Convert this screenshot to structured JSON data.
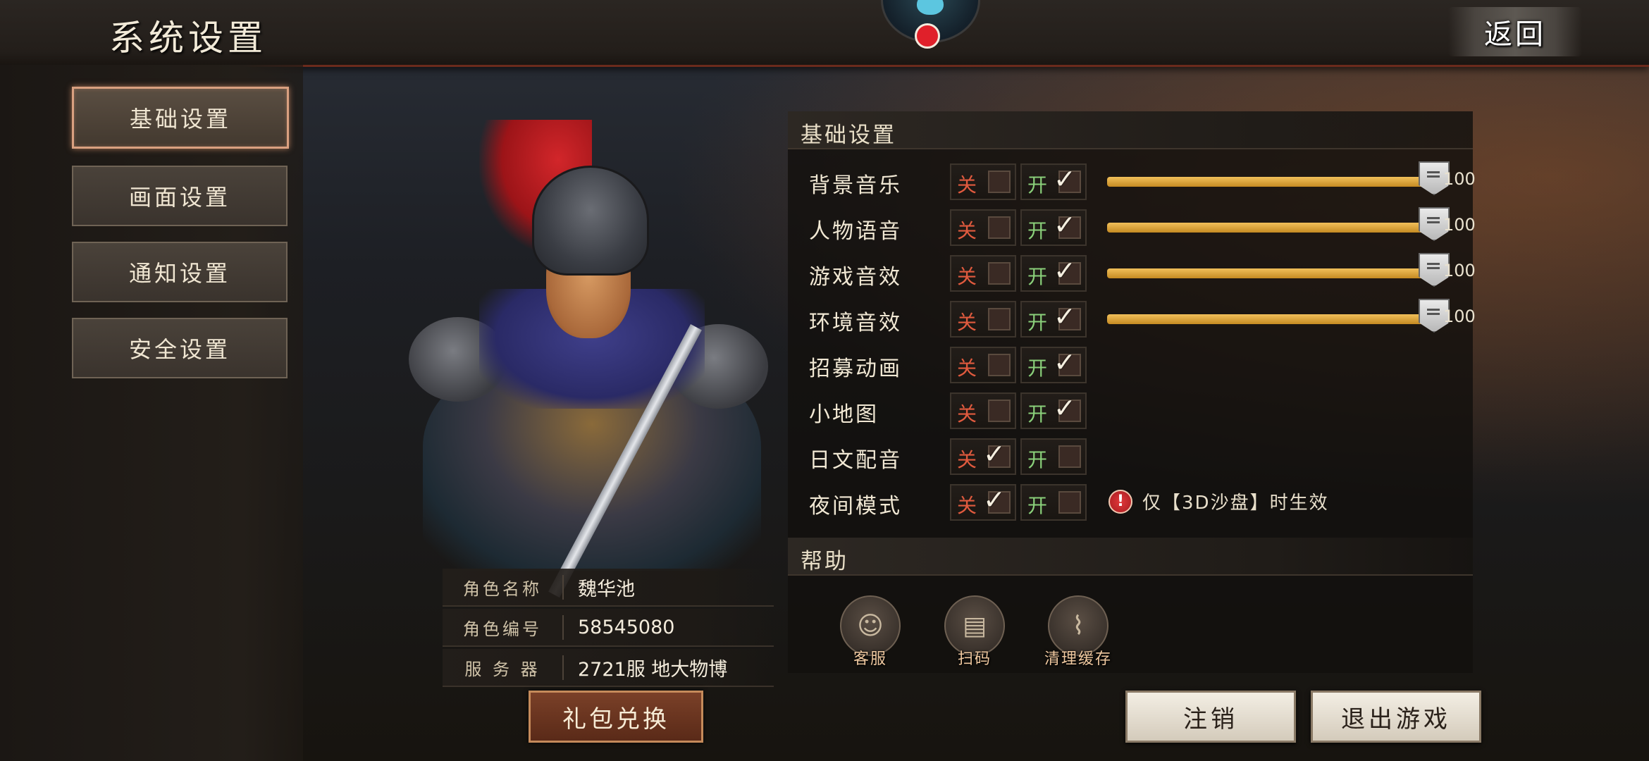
{
  "header": {
    "title": "系统设置",
    "back_label": "返回"
  },
  "nav": {
    "items": [
      {
        "label": "基础设置",
        "active": true
      },
      {
        "label": "画面设置",
        "active": false
      },
      {
        "label": "通知设置",
        "active": false
      },
      {
        "label": "安全设置",
        "active": false
      }
    ]
  },
  "character": {
    "rows": [
      {
        "label": "角色名称",
        "value": "魏华池"
      },
      {
        "label": "角色编号",
        "value": "58545080"
      },
      {
        "label": "服 务 器",
        "value": "2721服 地大物博"
      }
    ],
    "gift_button": "礼包兑换"
  },
  "basic": {
    "section_title": "基础设置",
    "off_label": "关",
    "on_label": "开",
    "settings": [
      {
        "label": "背景音乐",
        "enabled": true,
        "volume": "100"
      },
      {
        "label": "人物语音",
        "enabled": true,
        "volume": "100"
      },
      {
        "label": "游戏音效",
        "enabled": true,
        "volume": "100"
      },
      {
        "label": "环境音效",
        "enabled": true,
        "volume": "100"
      },
      {
        "label": "招募动画",
        "enabled": true
      },
      {
        "label": "小地图",
        "enabled": true
      },
      {
        "label": "日文配音",
        "enabled": false
      },
      {
        "label": "夜间模式",
        "enabled": false
      }
    ],
    "night_mode_note": "仅【3D沙盘】时生效",
    "warn_icon": "!"
  },
  "help": {
    "section_title": "帮助",
    "items": [
      {
        "label": "客服",
        "icon": "customer-service-icon"
      },
      {
        "label": "扫码",
        "icon": "scan-code-icon"
      },
      {
        "label": "清理缓存",
        "icon": "broom-icon"
      }
    ]
  },
  "footer": {
    "logout_label": "注销",
    "exit_label": "退出游戏"
  },
  "colors": {
    "accent_gold": "#c58a22",
    "off_red": "#e05a3e",
    "on_green": "#8ad07a",
    "active_nav_border": "#d9a080"
  }
}
